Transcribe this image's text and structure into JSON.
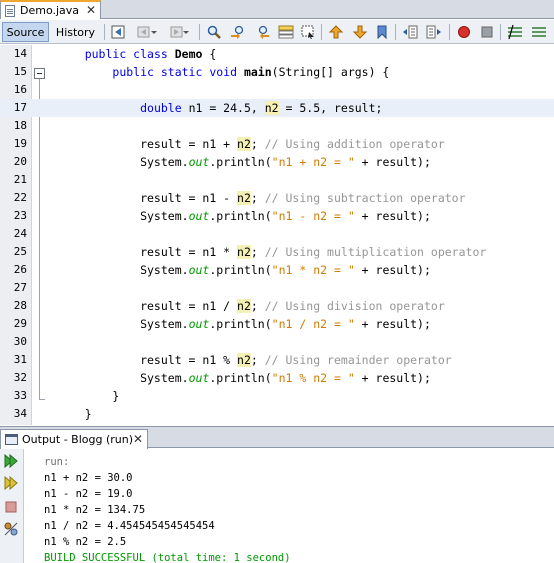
{
  "editor_tab": {
    "title": "Demo.java",
    "close": "✕"
  },
  "toolbar": {
    "source_label": "Source",
    "history_label": "History"
  },
  "code_lines": [
    {
      "num": "14",
      "html": "    <span class=\"kw\">public class</span> <span class=\"bold\">Demo</span> {"
    },
    {
      "num": "15",
      "html": "        <span class=\"kw\">public static void</span> <span class=\"bold\">main</span>(String[] args) {"
    },
    {
      "num": "16",
      "html": ""
    },
    {
      "num": "17",
      "html": "            <span class=\"kw\">double</span> n1 = 24.5, <span class=\"mark\">n2</span> = 5.5, result;"
    },
    {
      "num": "18",
      "html": ""
    },
    {
      "num": "19",
      "html": "            result = n1 + <span class=\"mark\">n2</span>; <span class=\"cm\">// Using addition operator</span>"
    },
    {
      "num": "20",
      "html": "            System.<span class=\"fld\">out</span>.println(<span class=\"str\">\"n1 + n2 = \"</span> + result);"
    },
    {
      "num": "21",
      "html": ""
    },
    {
      "num": "22",
      "html": "            result = n1 - <span class=\"mark\">n2</span>; <span class=\"cm\">// Using subtraction operator</span>"
    },
    {
      "num": "23",
      "html": "            System.<span class=\"fld\">out</span>.println(<span class=\"str\">\"n1 - n2 = \"</span> + result);"
    },
    {
      "num": "24",
      "html": ""
    },
    {
      "num": "25",
      "html": "            result = n1 * <span class=\"mark\">n2</span>; <span class=\"cm\">// Using multiplication operator</span>"
    },
    {
      "num": "26",
      "html": "            System.<span class=\"fld\">out</span>.println(<span class=\"str\">\"n1 * n2 = \"</span> + result);"
    },
    {
      "num": "27",
      "html": ""
    },
    {
      "num": "28",
      "html": "            result = n1 / <span class=\"mark\">n2</span>; <span class=\"cm\">// Using division operator</span>"
    },
    {
      "num": "29",
      "html": "            System.<span class=\"fld\">out</span>.println(<span class=\"str\">\"n1 / n2 = \"</span> + result);"
    },
    {
      "num": "30",
      "html": ""
    },
    {
      "num": "31",
      "html": "            result = n1 % <span class=\"mark\">n2</span>; <span class=\"cm\">// Using remainder operator</span>"
    },
    {
      "num": "32",
      "html": "            System.<span class=\"fld\">out</span>.println(<span class=\"str\">\"n1 % n2 = \"</span> + result);"
    },
    {
      "num": "33",
      "html": "        }"
    },
    {
      "num": "34",
      "html": "    }"
    }
  ],
  "current_line": "17",
  "output": {
    "tab_title": "Output - Blogg (run)",
    "close": "✕",
    "lines": [
      {
        "text": "run:",
        "kind": "run"
      },
      {
        "text": "n1 + n2 = 30.0",
        "kind": "normal"
      },
      {
        "text": "n1 - n2 = 19.0",
        "kind": "normal"
      },
      {
        "text": "n1 * n2 = 134.75",
        "kind": "normal"
      },
      {
        "text": "n1 / n2 = 4.454545454545454",
        "kind": "normal"
      },
      {
        "text": "n1 % n2 = 2.5",
        "kind": "normal"
      },
      {
        "text": "BUILD SUCCESSFUL (total time: 1 second)",
        "kind": "ok"
      }
    ]
  },
  "colors": {
    "keyword": "#0000e6",
    "string": "#ce7b00",
    "comment": "#969696",
    "field": "#009900",
    "highlight": "#f5f1b4",
    "build_ok": "#009900"
  }
}
